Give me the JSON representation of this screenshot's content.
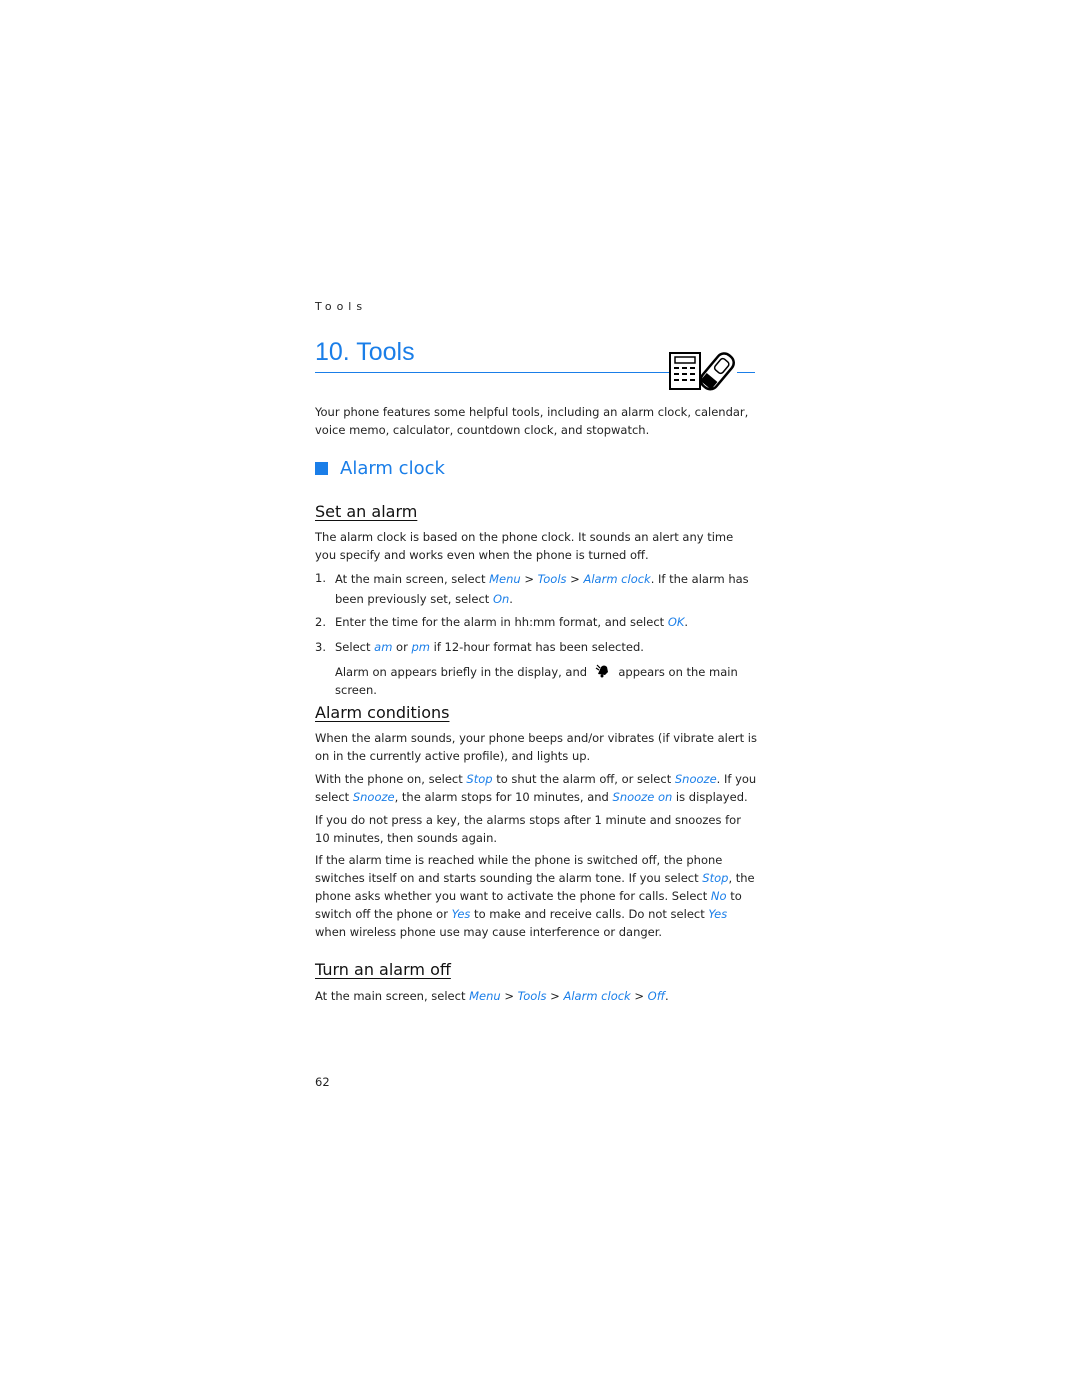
{
  "header": {
    "running_title": "Tools"
  },
  "chapter": {
    "title": "10. Tools",
    "icon": "calculator-phone-icon"
  },
  "intro": "Your phone features some helpful tools, including an alarm clock, calendar, voice memo, calculator, countdown clock, and stopwatch.",
  "section": {
    "title": "Alarm clock"
  },
  "set_alarm": {
    "title": "Set an alarm",
    "para": "The alarm clock is based on the phone clock. It sounds an alert any time you specify and works even when the phone is turned off.",
    "step1": {
      "num": "1.",
      "a": "At the main screen, select ",
      "menu": "Menu",
      "gt1": " > ",
      "tools": "Tools",
      "gt2": " > ",
      "alarm": "Alarm clock",
      "b": ". If the alarm has been previously set, select ",
      "on": "On",
      "c": "."
    },
    "step2": {
      "num": "2.",
      "a": "Enter the time for the alarm in hh:mm format, and select ",
      "ok": "OK",
      "b": "."
    },
    "step3": {
      "num": "3.",
      "a": "Select ",
      "am": "am",
      "b": " or ",
      "pm": "pm",
      "c": " if 12-hour format has been selected."
    },
    "note": {
      "a": "Alarm on appears briefly in the display, and ",
      "icon": "alarm-bell-icon",
      "b": " appears on the main screen."
    }
  },
  "conditions": {
    "title": "Alarm conditions",
    "p1": "When the alarm sounds, your phone beeps and/or vibrates (if vibrate alert is on in the currently active profile), and lights up.",
    "p2": {
      "a": "With the phone on, select ",
      "stop": "Stop",
      "b": " to shut the alarm off, or select ",
      "snooze": "Snooze",
      "c": ". If you select ",
      "snooze2": "Snooze",
      "d": ", the alarm stops for 10 minutes, and ",
      "snooze_on": "Snooze on",
      "e": " is displayed."
    },
    "p3": "If you do not press a key, the alarms stops after 1 minute and snoozes for 10 minutes, then sounds again.",
    "p4": {
      "a": "If the alarm time is reached while the phone is switched off, the phone switches itself on and starts sounding the alarm tone. If you select ",
      "stop": "Stop",
      "b": ", the phone asks whether you want to activate the phone for calls. Select ",
      "no": "No",
      "c": " to switch off the phone or ",
      "yes": "Yes",
      "d": " to make and receive calls. Do not select ",
      "yes2": "Yes",
      "e": " when wireless phone use may cause interference or danger."
    }
  },
  "turn_off": {
    "title": "Turn an alarm off",
    "p": {
      "a": "At the main screen, select ",
      "menu": "Menu",
      "gt1": " > ",
      "tools": "Tools",
      "gt2": " > ",
      "alarm": "Alarm clock",
      "gt3": " > ",
      "off": "Off",
      "b": "."
    }
  },
  "footer": {
    "page_number": "62"
  }
}
